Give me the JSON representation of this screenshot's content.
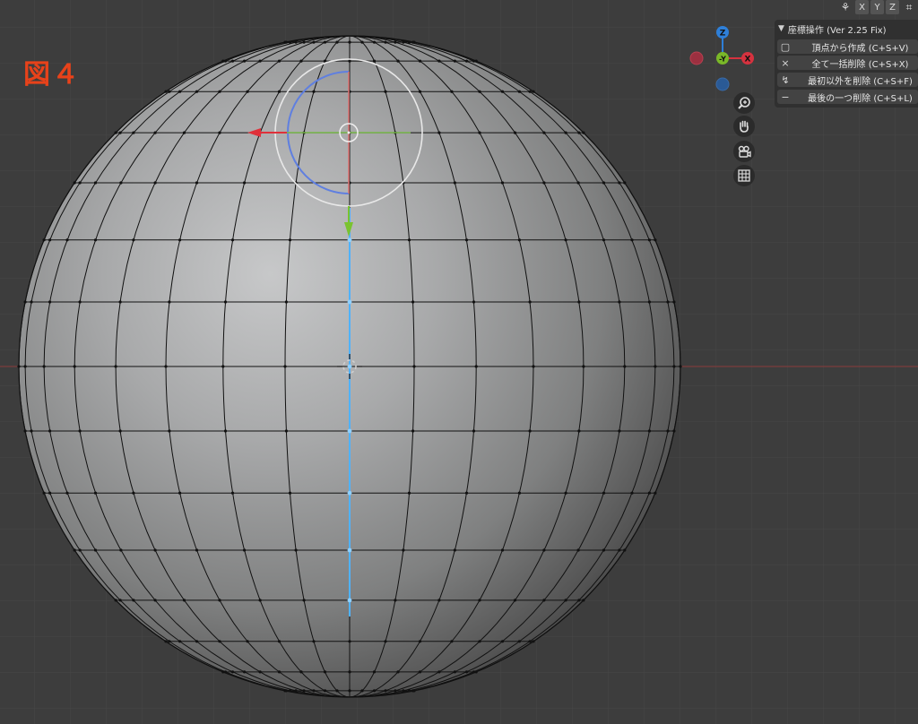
{
  "figure_label": "図４",
  "header_toggles": {
    "mirror_icon": "butterfly-icon",
    "axes": [
      "X",
      "Y",
      "Z"
    ],
    "extra_icon": "snap-icon"
  },
  "gizmo": {
    "z": "Z",
    "y": "-Y",
    "x": "X",
    "colors": {
      "z": "#2e7fd8",
      "y": "#7ab828",
      "x": "#d6323f",
      "neg_x": "#9c3040",
      "neg_z": "#2a5a96"
    }
  },
  "panel": {
    "title": "座標操作 (Ver 2.25 Fix)",
    "ops": [
      {
        "icon": "add-vertex-icon",
        "label": "頂点から作成 (C+S+V)"
      },
      {
        "icon": "close-icon",
        "label": "全て一括削除 (C+S+X)"
      },
      {
        "icon": "keep-first-icon",
        "label": "最初以外を削除 (C+S+F)"
      },
      {
        "icon": "minus-icon",
        "label": "最後の一つ削除 (C+S+L)"
      }
    ]
  },
  "nav_buttons": [
    "zoom-icon",
    "hand-icon",
    "camera-icon",
    "grid-icon"
  ],
  "colors": {
    "background": "#3d3d3d",
    "grid": "#474747",
    "x_axis": "#8a3a3a",
    "selected_edge": "#4fb2ff",
    "figure_label": "#e8421a"
  }
}
